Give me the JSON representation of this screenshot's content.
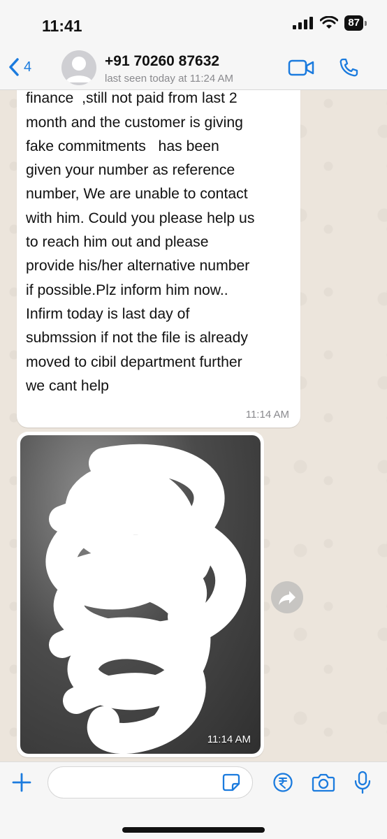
{
  "status_bar": {
    "time": "11:41",
    "battery": "87"
  },
  "header": {
    "back_count": "4",
    "contact_name": "+91 70260 87632",
    "contact_status": "last seen today at 11:24 AM"
  },
  "messages": [
    {
      "text": "from our company Nira\nfinance  ,still not paid from last 2\nmonth and the customer is giving\nfake commitments   has been\ngiven your number as reference\nnumber, We are unable to contact\nwith him. Could you please help us\nto reach him out and please\nprovide his/her alternative number\nif possible.Plz inform him now..\nInfirm today is last day of\nsubmssion if not the file is already\nmoved to cibil department further\nwe cant help",
      "time": "11:14 AM"
    },
    {
      "type": "image",
      "time": "11:14 AM"
    }
  ],
  "input": {
    "placeholder": "",
    "value": ""
  },
  "colors": {
    "accent": "#1b7bde",
    "chat_bg": "#ece5dc",
    "bubble": "#ffffff"
  }
}
